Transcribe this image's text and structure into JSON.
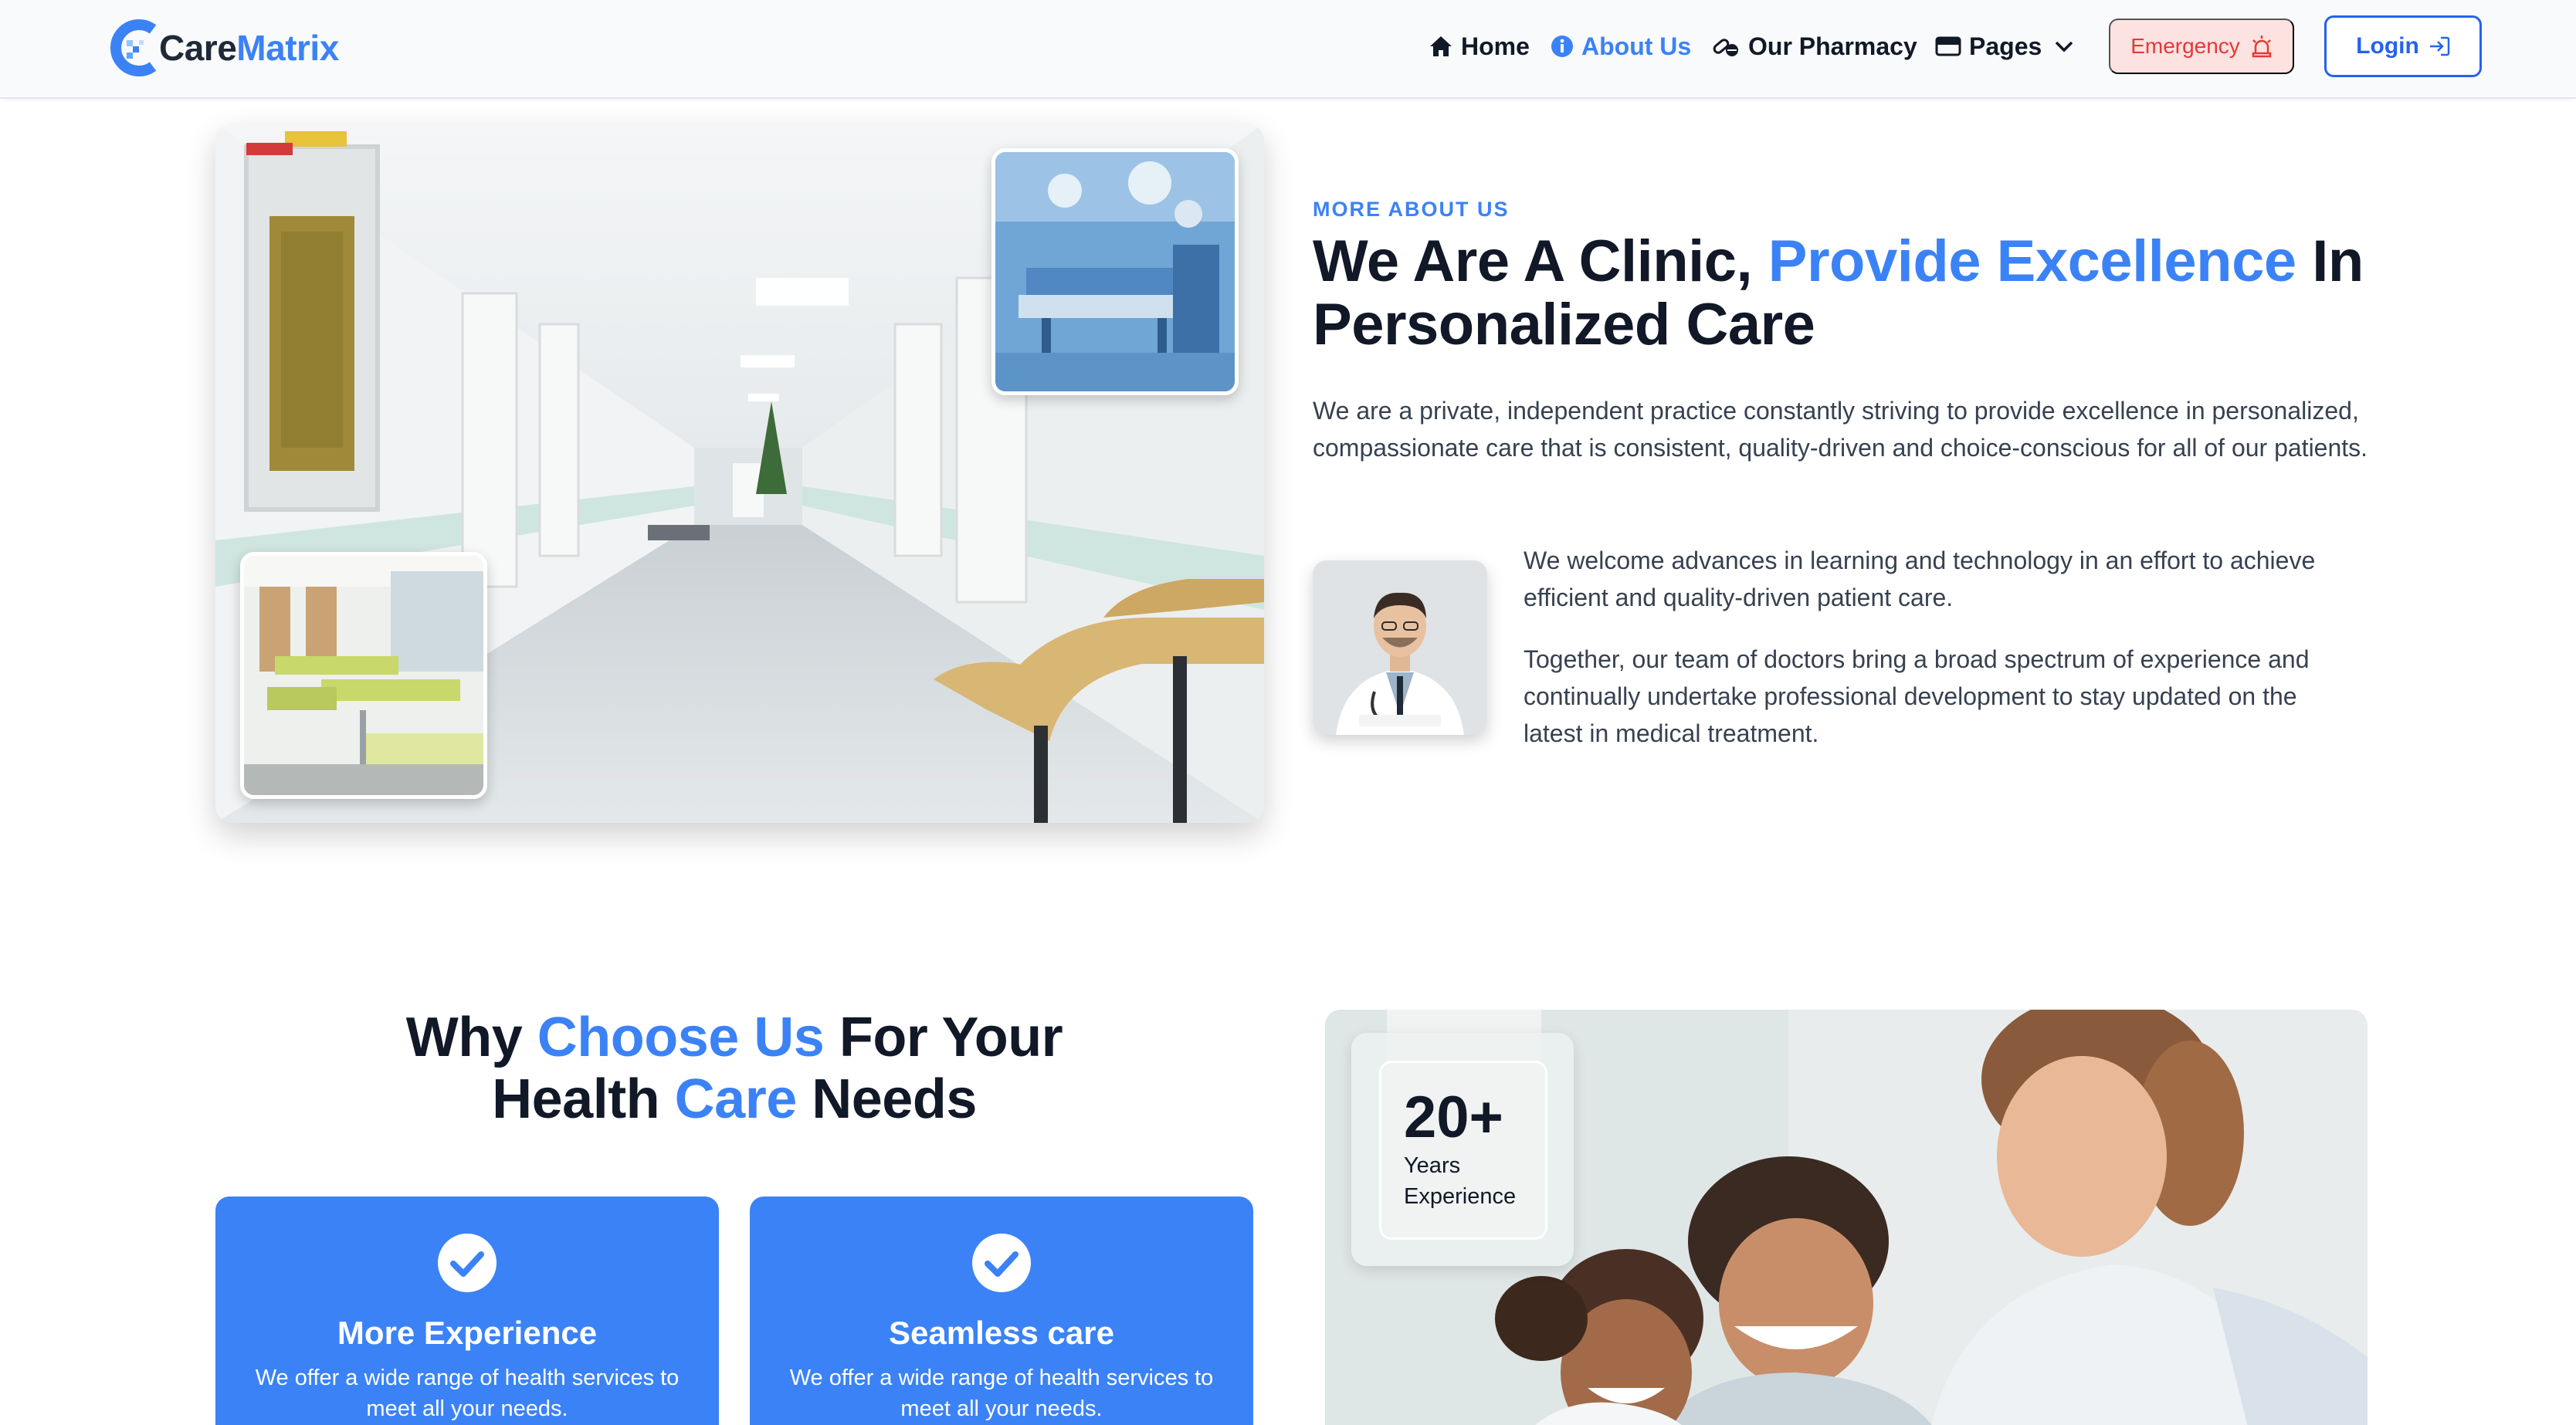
{
  "brand": {
    "name_part1": "Care",
    "name_part2": "Matrix",
    "primary_color": "#3b82f6"
  },
  "nav": {
    "home": "Home",
    "about": "About Us",
    "pharmacy": "Our Pharmacy",
    "pages": "Pages",
    "emergency": "Emergency",
    "login": "Login",
    "active_item": "About Us"
  },
  "about": {
    "eyebrow": "MORE ABOUT US",
    "title_part1": "We Are A Clinic, ",
    "title_highlight": "Provide Excellence",
    "title_part2": " In Personalized Care",
    "paragraph1": "We are a private, independent practice constantly striving to provide excellence in personalized, compassionate care that is consistent, quality-driven and choice-conscious for all of our patients.",
    "paragraph2": "We welcome advances in learning and technology in an effort to achieve efficient and quality-driven patient care.",
    "paragraph3": "Together, our team of doctors bring a broad spectrum of experience and continually undertake professional development to stay updated on the latest in medical treatment."
  },
  "why": {
    "title_part1": "Why ",
    "title_highlight1": "Choose Us",
    "title_part2": " For Your",
    "title_part3": "Health ",
    "title_highlight2": "Care",
    "title_part4": " Needs",
    "cards": [
      {
        "title": "More Experience",
        "desc": "We offer a wide range of health services to meet all your needs."
      },
      {
        "title": "Seamless care",
        "desc": "We offer a wide range of health services to meet all your needs."
      }
    ],
    "years_number": "20+",
    "years_label": "Years Experience"
  }
}
